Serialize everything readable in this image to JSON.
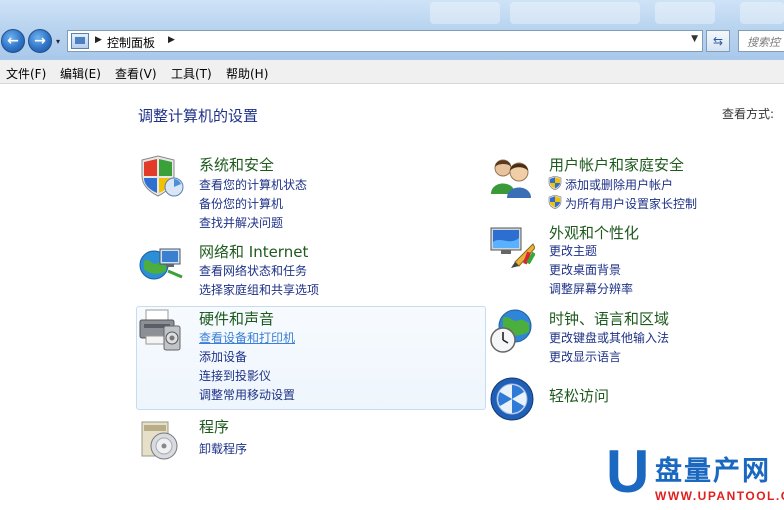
{
  "address": {
    "breadcrumb": "控制面板",
    "search_placeholder": "搜索控"
  },
  "menu": [
    "文件(F)",
    "编辑(E)",
    "查看(V)",
    "工具(T)",
    "帮助(H)"
  ],
  "page": {
    "title": "调整计算机的设置",
    "view_by": "查看方式:"
  },
  "categories": {
    "system": {
      "title": "系统和安全",
      "links": [
        "查看您的计算机状态",
        "备份您的计算机",
        "查找并解决问题"
      ]
    },
    "network": {
      "title": "网络和 Internet",
      "links": [
        "查看网络状态和任务",
        "选择家庭组和共享选项"
      ]
    },
    "hardware": {
      "title": "硬件和声音",
      "links": [
        "查看设备和打印机",
        "添加设备",
        "连接到投影仪",
        "调整常用移动设置"
      ]
    },
    "programs": {
      "title": "程序",
      "links": [
        "卸载程序"
      ]
    },
    "users": {
      "title": "用户帐户和家庭安全",
      "links": [
        "添加或删除用户帐户",
        "为所有用户设置家长控制"
      ]
    },
    "appearance": {
      "title": "外观和个性化",
      "links": [
        "更改主题",
        "更改桌面背景",
        "调整屏幕分辨率"
      ]
    },
    "clock": {
      "title": "时钟、语言和区域",
      "links": [
        "更改键盘或其他输入法",
        "更改显示语言"
      ]
    },
    "ease": {
      "title": "轻松访问",
      "links": []
    }
  },
  "watermark": {
    "letter": "U",
    "name": "盘量产网",
    "url": "WWW.UPANTOOL.COM"
  }
}
